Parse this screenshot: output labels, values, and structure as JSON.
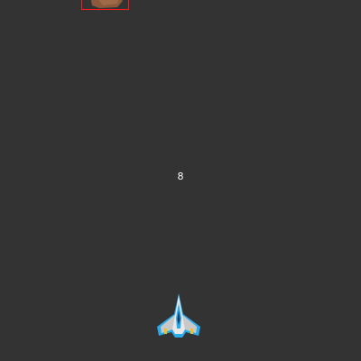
{
  "game": {
    "score": "8"
  },
  "colors": {
    "background": "#333333",
    "hitbox": "#ff1a1a",
    "asteroid": "#8b5a3c",
    "ship_body": "#e8e8e8",
    "ship_accent": "#2aaae8",
    "ship_flame": "#f0c020"
  },
  "sprites": {
    "enemy": "asteroid-icon",
    "player": "spaceship-icon"
  }
}
